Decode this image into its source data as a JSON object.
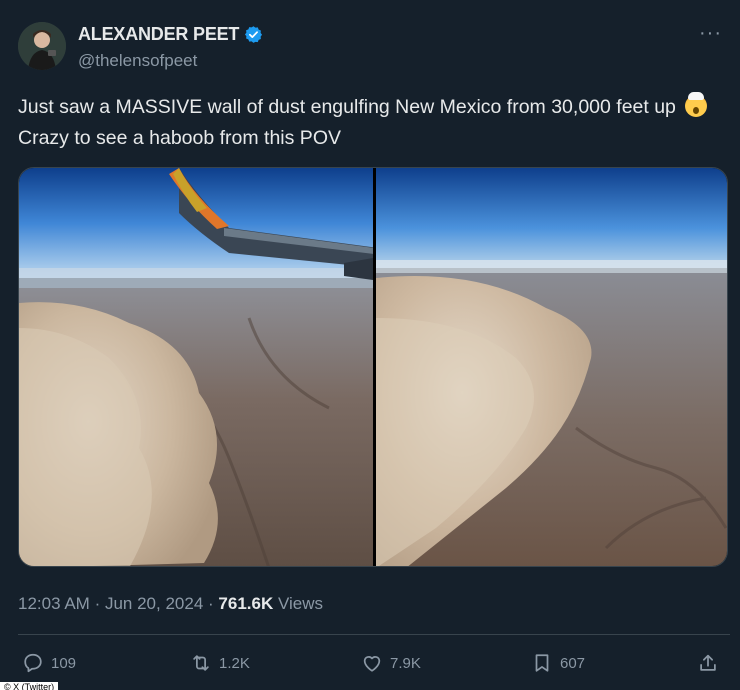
{
  "author": {
    "display_name": "ALEXANDER PEET",
    "handle": "@thelensofpeet",
    "verified": true,
    "avatar_icon": "profile-photo"
  },
  "more_icon": "ellipsis-icon",
  "tweet": {
    "text_part1": "Just saw a MASSIVE wall of dust engulfing New Mexico from 30,000 feet up",
    "emoji": "exploding-head-emoji",
    "text_part2": "Crazy to see a haboob from this POV"
  },
  "media": {
    "photos": [
      "haboob-photo-with-wing",
      "haboob-photo-aerial"
    ]
  },
  "meta": {
    "time": "12:03 AM",
    "separator": "·",
    "date": "Jun 20, 2024",
    "views_count": "761.6K",
    "views_label": "Views"
  },
  "actions": {
    "reply": {
      "icon": "reply-icon",
      "count": "109"
    },
    "retweet": {
      "icon": "retweet-icon",
      "count": "1.2K"
    },
    "like": {
      "icon": "heart-icon",
      "count": "7.9K"
    },
    "bookmark": {
      "icon": "bookmark-icon",
      "count": "607"
    },
    "share": {
      "icon": "share-icon"
    }
  },
  "credit": "© X (Twitter)",
  "colors": {
    "background": "#15202b",
    "text": "#e7e9ea",
    "muted": "#8b98a5",
    "verified": "#1d9bf0"
  }
}
